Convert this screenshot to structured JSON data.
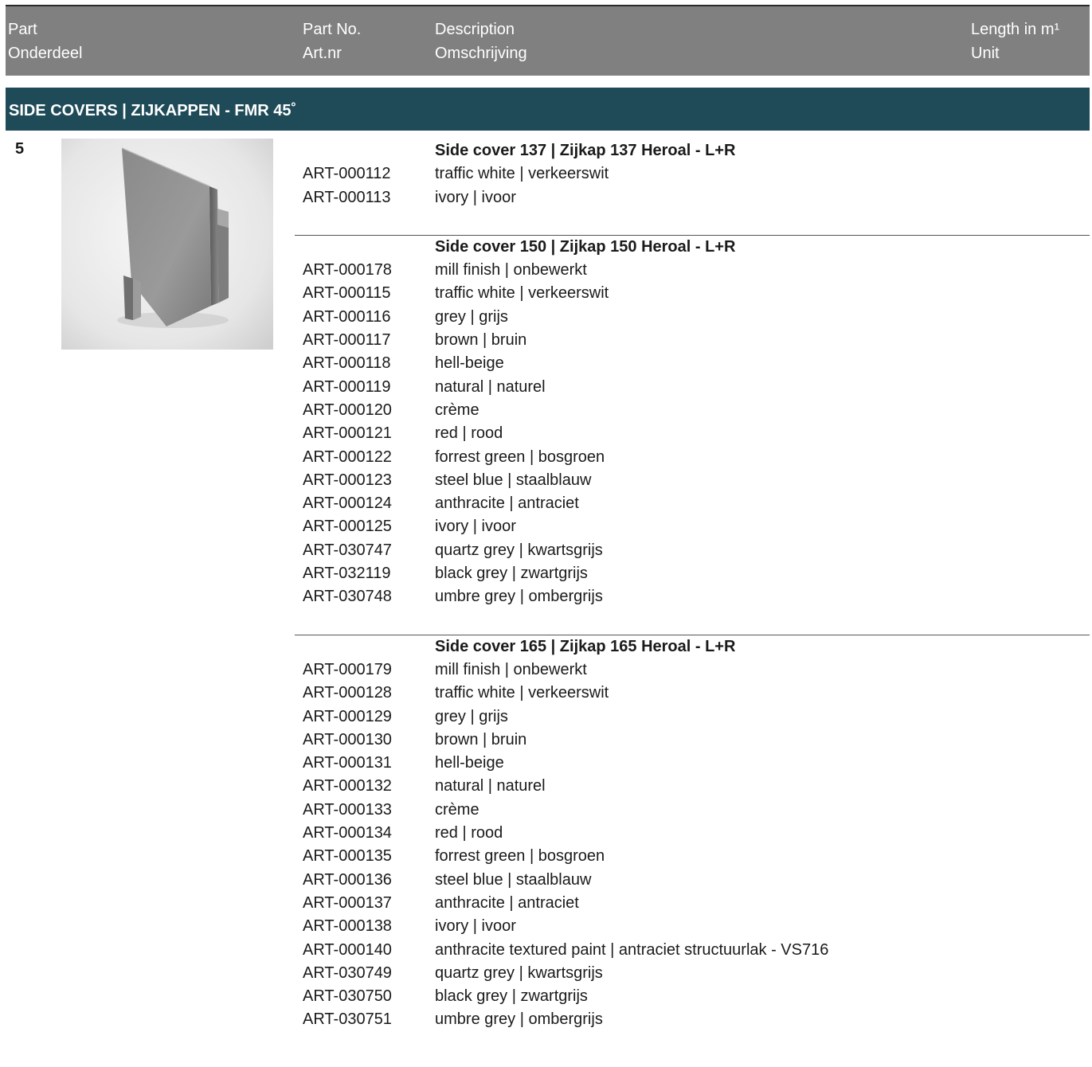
{
  "header": {
    "part": "Part",
    "part_nl": "Onderdeel",
    "part_no": "Part No.",
    "part_no_nl": "Art.nr",
    "description": "Description",
    "description_nl": "Omschrijving",
    "length": "Length in m¹",
    "unit": "Unit"
  },
  "section": {
    "title": "SIDE COVERS | ZIJKAPPEN  - FMR 45˚"
  },
  "part_number": "5",
  "groups": [
    {
      "title": "Side cover 137 | Zijkap 137 Heroal - L+R",
      "items": [
        {
          "art": "ART-000112",
          "desc": "traffic white | verkeerswit"
        },
        {
          "art": "ART-000113",
          "desc": "ivory | ivoor"
        }
      ]
    },
    {
      "title": "Side cover 150 | Zijkap 150 Heroal - L+R",
      "items": [
        {
          "art": "ART-000178",
          "desc": "mill finish | onbewerkt"
        },
        {
          "art": "ART-000115",
          "desc": "traffic white | verkeerswit"
        },
        {
          "art": "ART-000116",
          "desc": "grey | grijs"
        },
        {
          "art": "ART-000117",
          "desc": "brown | bruin"
        },
        {
          "art": "ART-000118",
          "desc": "hell-beige"
        },
        {
          "art": "ART-000119",
          "desc": "natural | naturel"
        },
        {
          "art": "ART-000120",
          "desc": "crème"
        },
        {
          "art": "ART-000121",
          "desc": "red | rood"
        },
        {
          "art": "ART-000122",
          "desc": "forrest green | bosgroen"
        },
        {
          "art": "ART-000123",
          "desc": "steel blue | staalblauw"
        },
        {
          "art": "ART-000124",
          "desc": "anthracite | antraciet"
        },
        {
          "art": "ART-000125",
          "desc": "ivory | ivoor"
        },
        {
          "art": "ART-030747",
          "desc": "quartz grey | kwartsgrijs"
        },
        {
          "art": "ART-032119",
          "desc": "black grey | zwartgrijs"
        },
        {
          "art": "ART-030748",
          "desc": "umbre grey | ombergrijs"
        }
      ]
    },
    {
      "title": "Side cover 165 | Zijkap 165 Heroal - L+R",
      "items": [
        {
          "art": "ART-000179",
          "desc": "mill finish | onbewerkt"
        },
        {
          "art": "ART-000128",
          "desc": "traffic white | verkeerswit"
        },
        {
          "art": "ART-000129",
          "desc": "grey | grijs"
        },
        {
          "art": "ART-000130",
          "desc": "brown | bruin"
        },
        {
          "art": "ART-000131",
          "desc": "hell-beige"
        },
        {
          "art": "ART-000132",
          "desc": "natural | naturel"
        },
        {
          "art": "ART-000133",
          "desc": "crème"
        },
        {
          "art": "ART-000134",
          "desc": "red | rood"
        },
        {
          "art": "ART-000135",
          "desc": "forrest green | bosgroen"
        },
        {
          "art": "ART-000136",
          "desc": "steel blue | staalblauw"
        },
        {
          "art": "ART-000137",
          "desc": "anthracite | antraciet"
        },
        {
          "art": "ART-000138",
          "desc": "ivory | ivoor"
        },
        {
          "art": "ART-000140",
          "desc": "anthracite textured paint | antraciet structuurlak - VS716"
        },
        {
          "art": "ART-030749",
          "desc": "quartz grey | kwartsgrijs"
        },
        {
          "art": "ART-030750",
          "desc": "black grey | zwartgrijs"
        },
        {
          "art": "ART-030751",
          "desc": "umbre grey | ombergrijs"
        }
      ]
    }
  ]
}
